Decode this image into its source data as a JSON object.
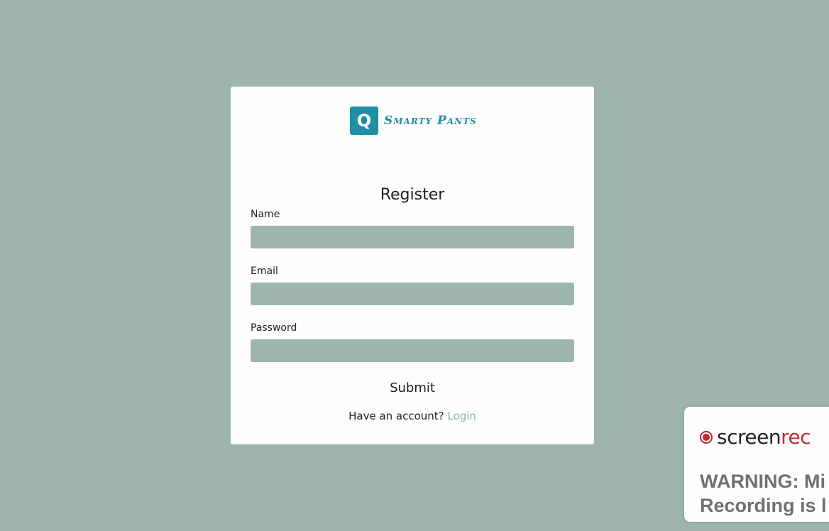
{
  "brand": {
    "logo_letter": "Q",
    "name": "Smarty Pants",
    "color": "#1f8fa3"
  },
  "form": {
    "title": "Register",
    "fields": [
      {
        "label": "Name",
        "value": "",
        "type": "text"
      },
      {
        "label": "Email",
        "value": "",
        "type": "email"
      },
      {
        "label": "Password",
        "value": "",
        "type": "password"
      }
    ],
    "submit_label": "Submit",
    "account_prompt": "Have an account?",
    "login_link": "Login"
  },
  "overlay": {
    "brand_prefix": "screen",
    "brand_suffix": "rec",
    "warning_line1": "WARNING: Mi",
    "warning_line2": "Recording is l"
  },
  "colors": {
    "background": "#9db5ad",
    "card": "#fdfdfd",
    "link": "#8fb1a4",
    "record_red": "#c0282d"
  }
}
